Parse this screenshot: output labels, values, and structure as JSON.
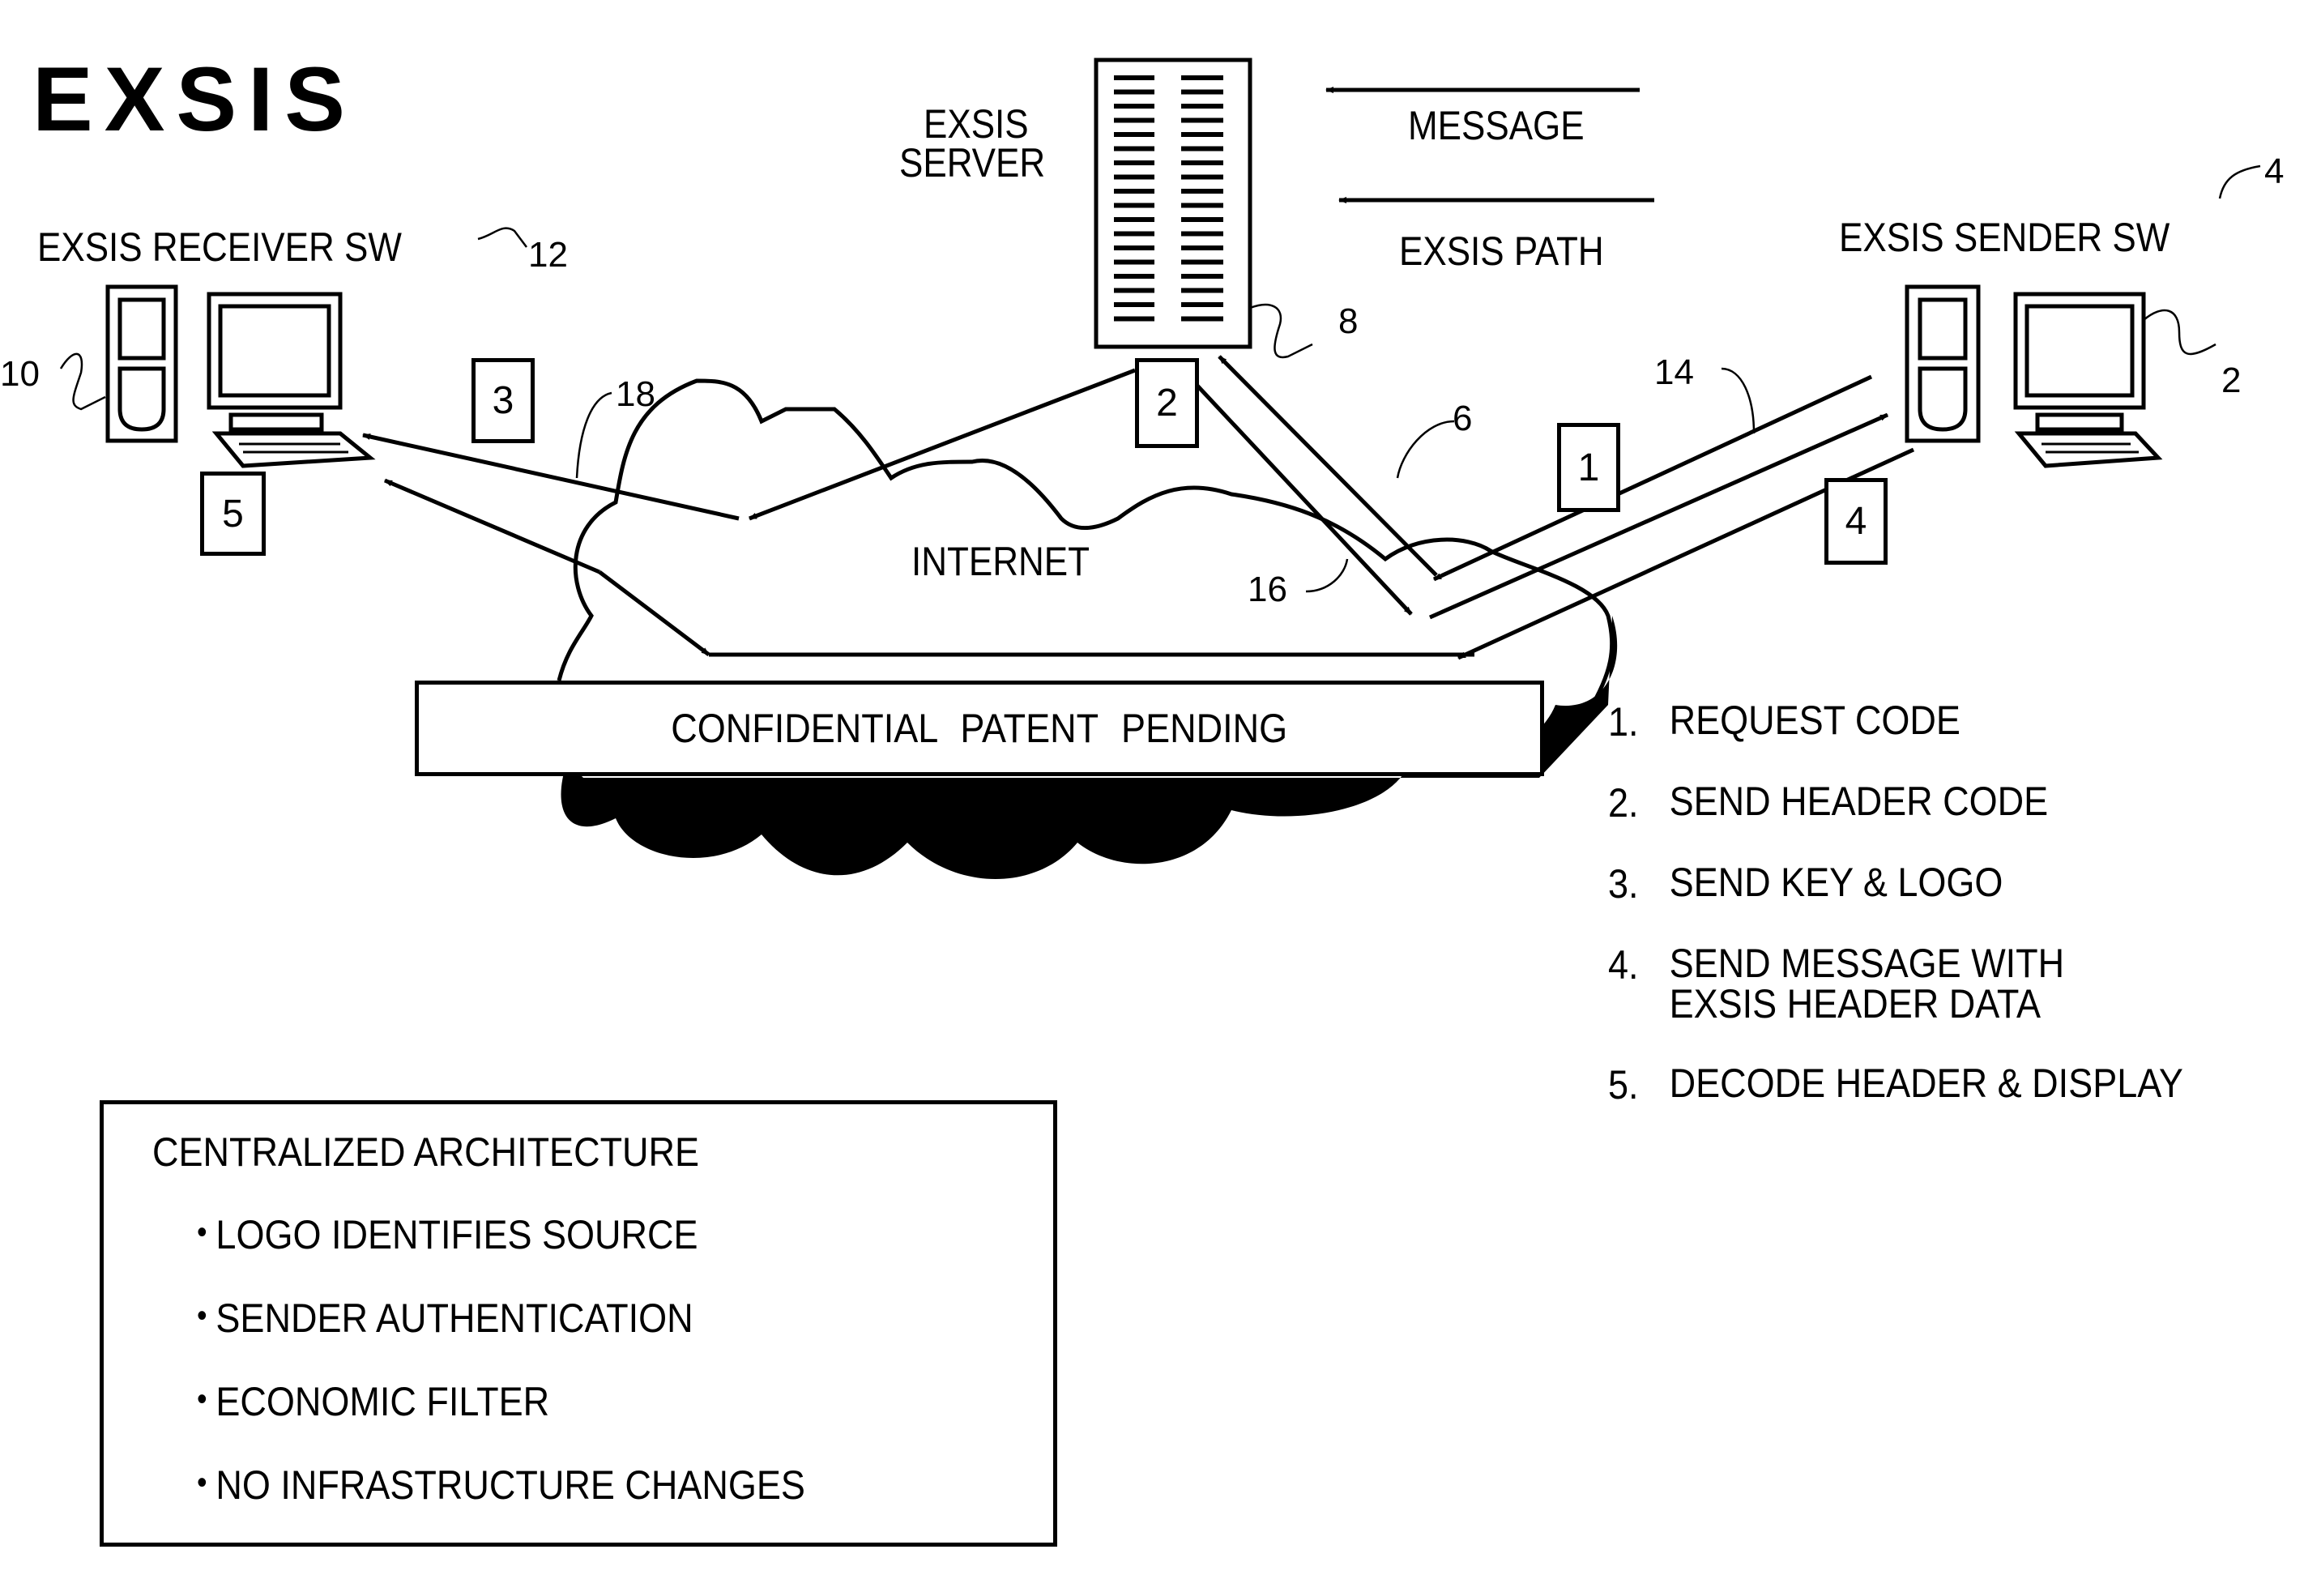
{
  "title": "EXSIS",
  "receiver": {
    "label": "EXSIS RECEIVER SW",
    "ref_software": "12",
    "ref_computer": "10"
  },
  "server": {
    "label_line1": "EXSIS",
    "label_line2": "SERVER",
    "ref": "8"
  },
  "sender": {
    "label": "EXSIS SENDER SW",
    "ref_software": "4",
    "ref_computer": "2"
  },
  "key": {
    "message_label": "MESSAGE",
    "path_label": "EXSIS PATH"
  },
  "network": {
    "label": "INTERNET",
    "ref_cloud": "6",
    "ref_path_sender": "14",
    "ref_path_server": "16",
    "ref_path_receiver": "18"
  },
  "step_boxes": [
    "1",
    "2",
    "3",
    "4",
    "5"
  ],
  "banner": "CONFIDENTIAL PATENT PENDING",
  "steps": [
    {
      "num": "1.",
      "text": "REQUEST CODE"
    },
    {
      "num": "2.",
      "text": "SEND HEADER CODE"
    },
    {
      "num": "3.",
      "text": "SEND KEY & LOGO"
    },
    {
      "num": "4.",
      "text": "SEND MESSAGE WITH",
      "text2": "EXSIS HEADER DATA"
    },
    {
      "num": "5.",
      "text": "DECODE HEADER & DISPLAY"
    }
  ],
  "architecture": {
    "heading": "CENTRALIZED ARCHITECTURE",
    "bullet": "•",
    "items": [
      "LOGO IDENTIFIES SOURCE",
      "SENDER AUTHENTICATION",
      "ECONOMIC FILTER",
      "NO INFRASTRUCTURE CHANGES"
    ]
  }
}
